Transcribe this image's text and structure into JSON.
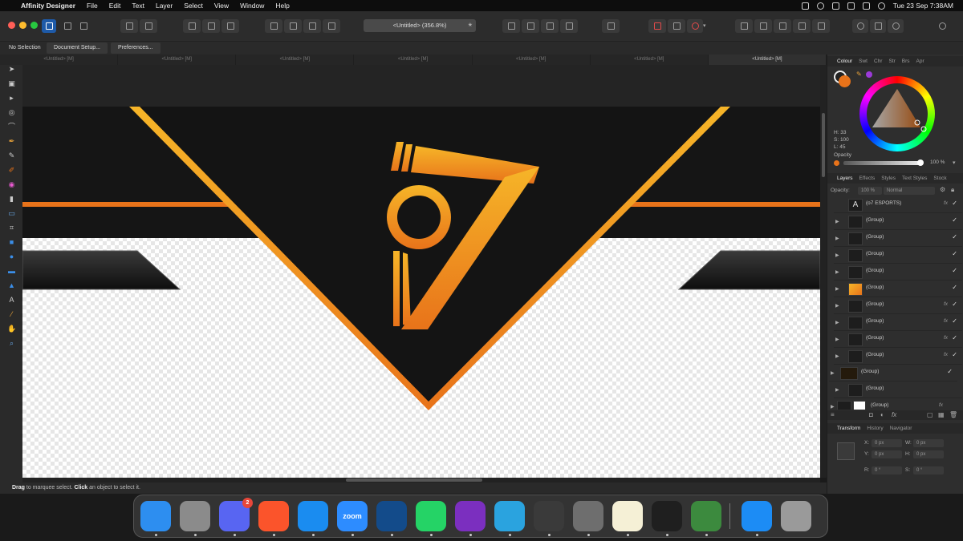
{
  "menubar": {
    "app": "Affinity Designer",
    "items": [
      "File",
      "Edit",
      "Text",
      "Layer",
      "Select",
      "View",
      "Window",
      "Help"
    ],
    "datetime": "Tue 23 Sep  7:38AM"
  },
  "toolbar": {
    "document_title": "<Untitled> (356.8%)"
  },
  "context_bar": {
    "selection": "No Selection",
    "document_setup": "Document Setup...",
    "preferences": "Preferences..."
  },
  "doc_tabs": [
    "<Untitled> [M]",
    "<Untitled> [M]",
    "<Untitled> [M]",
    "<Untitled> [M]",
    "<Untitled> [M]",
    "<Untitled> [M]",
    "<Untitled> [M]"
  ],
  "colour_panel": {
    "tabs": [
      "Colour",
      "Swt",
      "Chr",
      "Str",
      "Brs",
      "Apr"
    ],
    "h": "H: 33",
    "s": "S: 100",
    "l": "L: 45",
    "opacity_label": "Opacity",
    "opacity_value": "100 %",
    "opacity_fraction": 1.0,
    "swatch_color": "#e8731a"
  },
  "layers_panel": {
    "tabs": [
      "Layers",
      "Effects",
      "Styles",
      "Text Styles",
      "Stock"
    ],
    "opacity_label": "Opacity:",
    "opacity_value": "100 %",
    "blend_mode": "Normal",
    "rows": [
      {
        "name": "(o7 ESPORTS)",
        "fx": "fx",
        "check": "✓"
      },
      {
        "name": "(Group)",
        "fx": "",
        "check": "✓"
      },
      {
        "name": "(Group)",
        "fx": "",
        "check": "✓"
      },
      {
        "name": "(Group)",
        "fx": "",
        "check": "✓"
      },
      {
        "name": "(Group)",
        "fx": "",
        "check": "✓"
      },
      {
        "name": "(Group)",
        "fx": "",
        "check": "✓"
      },
      {
        "name": "(Group)",
        "fx": "fx",
        "check": "✓"
      },
      {
        "name": "(Group)",
        "fx": "fx",
        "check": "✓"
      },
      {
        "name": "(Group)",
        "fx": "fx",
        "check": "✓"
      },
      {
        "name": "(Group)",
        "fx": "fx",
        "check": "✓"
      },
      {
        "name": "(Group)",
        "fx": "",
        "check": "✓"
      },
      {
        "name": "(Group)",
        "fx": "",
        "check": ""
      },
      {
        "name": "(Group)",
        "fx": "fx",
        "check": ""
      }
    ]
  },
  "transform_panel": {
    "tabs": [
      "Transform",
      "History",
      "Navigator"
    ],
    "x_label": "X:",
    "x": "0 px",
    "y_label": "Y:",
    "y": "0 px",
    "w_label": "W:",
    "w": "0 px",
    "h_label": "H:",
    "h": "0 px",
    "r_label": "R:",
    "r": "0 °",
    "s_label": "S:",
    "s": "0 °"
  },
  "status": {
    "drag": "Drag",
    "drag_text": " to marquee select. ",
    "click": "Click",
    "click_text": " an object to select it."
  },
  "dock": {
    "items": [
      {
        "name": "finder",
        "label": "",
        "color": "#2d8ef0"
      },
      {
        "name": "launchpad",
        "label": "",
        "color": "#8b8b8b"
      },
      {
        "name": "discord",
        "label": "",
        "color": "#5865f2",
        "badge": "2"
      },
      {
        "name": "brave",
        "label": "",
        "color": "#fb542b"
      },
      {
        "name": "safari",
        "label": "",
        "color": "#1a8cf0"
      },
      {
        "name": "zoom",
        "label": "zoom",
        "color": "#2d8cff"
      },
      {
        "name": "affinity-designer",
        "label": "",
        "color": "#134b8a"
      },
      {
        "name": "whatsapp",
        "label": "",
        "color": "#25d366"
      },
      {
        "name": "affinity-photo",
        "label": "",
        "color": "#7b2fbf"
      },
      {
        "name": "telegram",
        "label": "",
        "color": "#2aa3df"
      },
      {
        "name": "blender",
        "label": "",
        "color": "#3a3a3a"
      },
      {
        "name": "system-settings",
        "label": "",
        "color": "#6e6e6e"
      },
      {
        "name": "notes",
        "label": "",
        "color": "#f5f0d6"
      },
      {
        "name": "stocks",
        "label": "",
        "color": "#1f1f1f"
      },
      {
        "name": "metatrader",
        "label": "",
        "color": "#3c8a3e"
      },
      {
        "name": "app-store",
        "label": "",
        "color": "#1c8cf5"
      },
      {
        "name": "trash",
        "label": "",
        "color": "#9a9a9a"
      }
    ]
  },
  "colors": {
    "accent": "#e8731a",
    "gold": "#f6b528",
    "canvas_dark": "#161616"
  }
}
